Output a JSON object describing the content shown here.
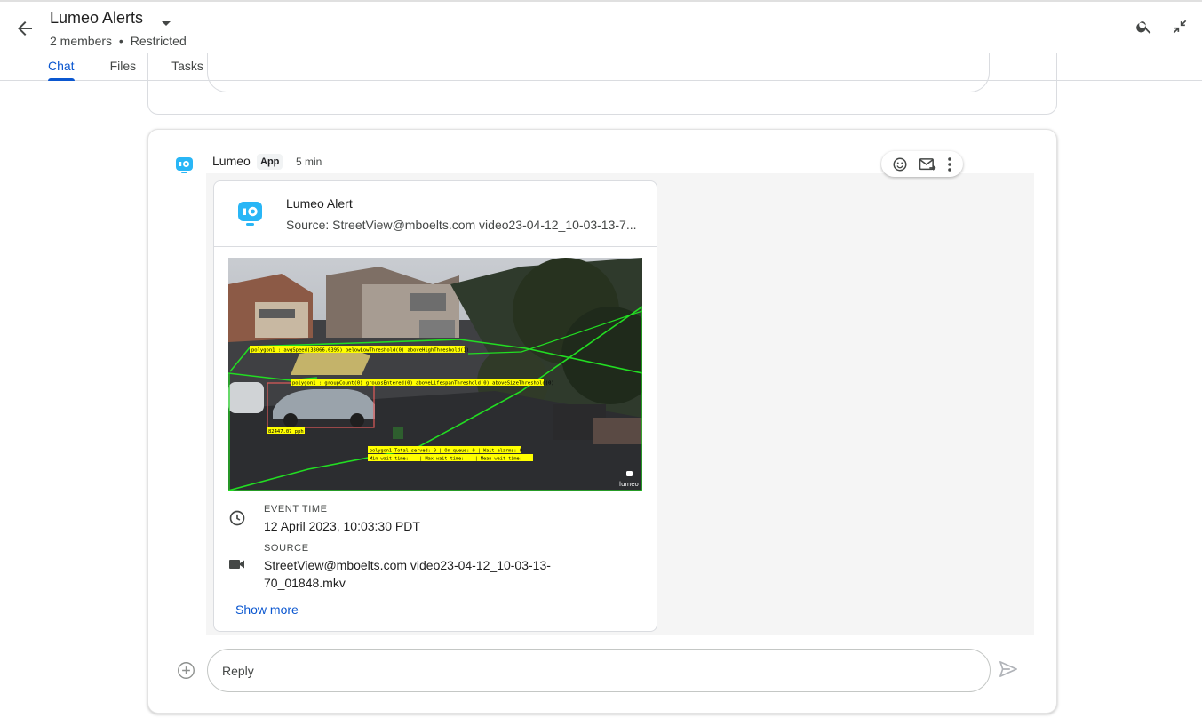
{
  "header": {
    "title": "Lumeo Alerts",
    "subtitle_members": "2 members",
    "subtitle_separator": "•",
    "subtitle_access": "Restricted",
    "tabs": [
      {
        "label": "Chat",
        "active": true
      },
      {
        "label": "Files",
        "active": false
      },
      {
        "label": "Tasks",
        "active": false
      }
    ],
    "icons": {
      "back": "arrow-back-icon",
      "dropdown": "caret-down-icon",
      "search": "search-icon",
      "collapse": "collapse-icon"
    }
  },
  "message": {
    "sender": "Lumeo",
    "badge": "App",
    "time": "5 min",
    "actions": [
      "emoji-icon",
      "forward-to-inbox-icon",
      "more-vert-icon"
    ],
    "card": {
      "title": "Lumeo Alert",
      "source_header": "Source: StreetView@mboelts.com video23-04-12_10-03-13-7...",
      "overlay": {
        "label1": "polygon1 : avgSpeed(33066.6395) belowLowThreshold(0) aboveHighThreshold(1)",
        "label2": "polygon1 : groupCount(0) groupsEntered(0) aboveLifespanThreshold(0) aboveSizeThreshold(0)",
        "speed": "82447.07 pph",
        "queue1": "polygon1 Total served: 0 | On queue: 0 | Wait alarms: 0",
        "queue2": "Min wait time: -- | Max wait time: -- | Mean wait time: --",
        "watermark": "lumeo"
      },
      "event_time_label": "EVENT TIME",
      "event_time": "12 April 2023, 10:03:30 PDT",
      "source_label": "SOURCE",
      "source_line1": "StreetView@mboelts.com video23-04-12_10-03-13-",
      "source_line2": "70_01848.mkv",
      "show_more": "Show more"
    }
  },
  "reply": {
    "placeholder": "Reply"
  },
  "colors": {
    "accent": "#0b57d0",
    "lumeo_blue": "#29b6f6",
    "overlay_yellow": "#ffff00",
    "overlay_green": "#22dd22"
  }
}
